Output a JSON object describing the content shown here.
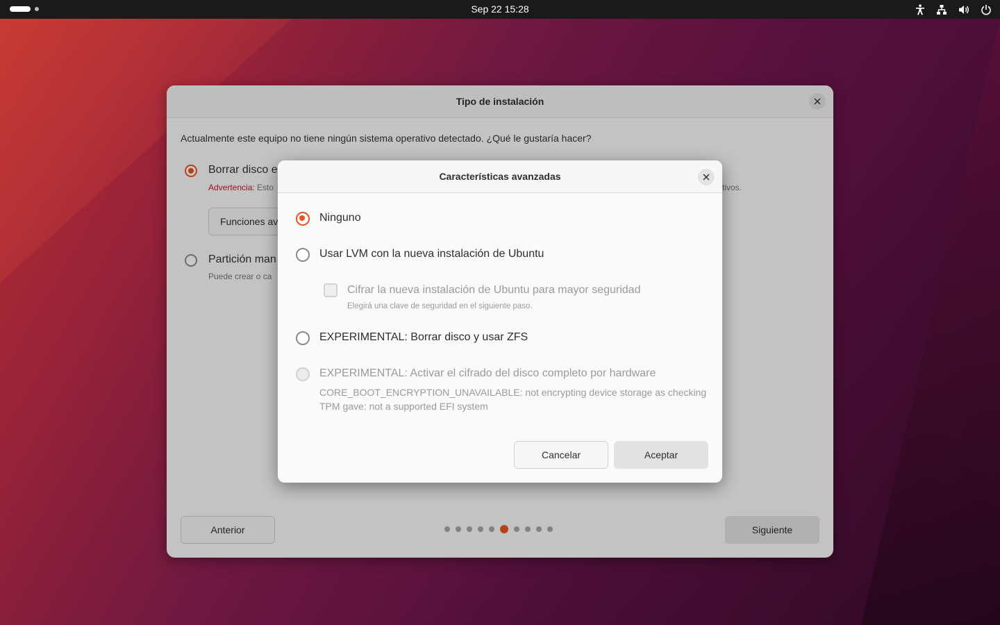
{
  "topbar": {
    "clock": "Sep 22  15:28",
    "icons": [
      "accessibility-icon",
      "network-icon",
      "volume-icon",
      "power-icon"
    ]
  },
  "installer": {
    "title": "Tipo de instalación",
    "question": "Actualmente este equipo no tiene ningún sistema operativo detectado. ¿Qué le gustaría hacer?",
    "option_erase": {
      "label": "Borrar disco e",
      "warning_prefix": "Advertencia:",
      "warning_text": "Esto",
      "warning_tail": "tivos.",
      "advanced_button": "Funciones av"
    },
    "option_manual": {
      "label": "Partición man",
      "desc": "Puede crear o ca"
    },
    "back_button": "Anterior",
    "next_button": "Siguiente",
    "pager": {
      "total": 10,
      "current": 6
    }
  },
  "dialog": {
    "title": "Características avanzadas",
    "options": {
      "none": "Ninguno",
      "lvm": "Usar LVM con la nueva instalación de Ubuntu",
      "encrypt": "Cifrar la nueva instalación de Ubuntu para mayor seguridad",
      "encrypt_hint": "Elegirá una clave de seguridad en el siguiente paso.",
      "zfs": "EXPERIMENTAL: Borrar disco y usar ZFS",
      "hw_encrypt": "EXPERIMENTAL: Activar el cifrado del disco completo por hardware",
      "hw_encrypt_desc": "CORE_BOOT_ENCRYPTION_UNAVAILABLE: not encrypting device storage as checking TPM gave: not a supported EFI system"
    },
    "selected": "none",
    "cancel_button": "Cancelar",
    "accept_button": "Aceptar"
  },
  "colors": {
    "accent": "#e95420",
    "warning": "#c7162b",
    "topbar": "#1a1a1a"
  }
}
